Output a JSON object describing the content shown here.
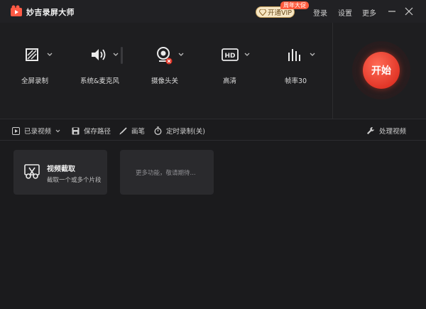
{
  "app": {
    "title": "妙吉录屏大师",
    "vip_label": "开通VIP",
    "vip_badge": "周年大促",
    "login": "登录",
    "settings": "设置",
    "more": "更多"
  },
  "tools": [
    {
      "label": "全屏录制",
      "icon": "fullscreen-capture-icon",
      "has_dropdown": true
    },
    {
      "label": "系统&麦克风",
      "icon": "speaker-icon",
      "has_dropdown": true,
      "volume_level": 0
    },
    {
      "label": "摄像头关",
      "icon": "webcam-off-icon",
      "has_dropdown": true
    },
    {
      "label": "高清",
      "icon": "hd-icon",
      "has_dropdown": true
    },
    {
      "label": "帧率30",
      "icon": "framerate-icon",
      "has_dropdown": true
    }
  ],
  "start_label": "开始",
  "subbar": {
    "recorded_videos": "已录视频",
    "save_path": "保存路径",
    "brush": "画笔",
    "timed_record": "定时录制(关)",
    "process_video": "处理视频"
  },
  "cards": {
    "clip": {
      "title": "视频截取",
      "desc": "截取一个或多个片段"
    },
    "more": {
      "text": "更多功能，敬请期待..."
    }
  },
  "colors": {
    "accent": "#e03325",
    "background": "#1b1b1d",
    "vip_gold": "#f6e6c4"
  }
}
